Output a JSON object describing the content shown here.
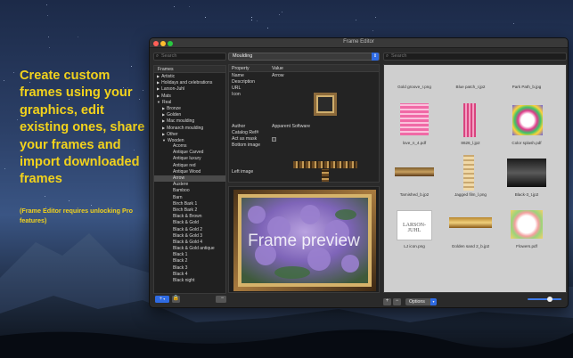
{
  "promo": {
    "headline": "Create custom frames using your graphics, edit existing ones, share your frames and import downloaded frames",
    "note": "(Frame Editor requires unlocking Pro features)"
  },
  "window": {
    "title": "Frame Editor",
    "traffic_lights": {
      "close": "#ff5f57",
      "minimize": "#febc2e",
      "zoom": "#28c840"
    }
  },
  "left_pane": {
    "search_placeholder": "Search",
    "header": "Frames",
    "tree": [
      {
        "label": "Artistic",
        "indent": 0,
        "arrow": "▶"
      },
      {
        "label": "Holidays and celebrations",
        "indent": 0,
        "arrow": "▶"
      },
      {
        "label": "Larson-Juhl",
        "indent": 0,
        "arrow": "▶"
      },
      {
        "label": "Mats",
        "indent": 0,
        "arrow": "▶"
      },
      {
        "label": "Real",
        "indent": 0,
        "arrow": "▼"
      },
      {
        "label": "Bronze",
        "indent": 1,
        "arrow": "▶"
      },
      {
        "label": "Golden",
        "indent": 1,
        "arrow": "▶"
      },
      {
        "label": "Mac moulding",
        "indent": 1,
        "arrow": "▶"
      },
      {
        "label": "Monarch moulding",
        "indent": 1,
        "arrow": "▶"
      },
      {
        "label": "Other",
        "indent": 1,
        "arrow": "▶"
      },
      {
        "label": "Wooden",
        "indent": 1,
        "arrow": "▼"
      },
      {
        "label": "Acorns",
        "indent": 2,
        "arrow": ""
      },
      {
        "label": "Antique Carved",
        "indent": 2,
        "arrow": ""
      },
      {
        "label": "Antique luxury",
        "indent": 2,
        "arrow": ""
      },
      {
        "label": "Antique red",
        "indent": 2,
        "arrow": ""
      },
      {
        "label": "Antique Wood",
        "indent": 2,
        "arrow": ""
      },
      {
        "label": "Arrow",
        "indent": 2,
        "arrow": "",
        "selected": true
      },
      {
        "label": "Austere",
        "indent": 2,
        "arrow": ""
      },
      {
        "label": "Bamboo",
        "indent": 2,
        "arrow": ""
      },
      {
        "label": "Barn",
        "indent": 2,
        "arrow": ""
      },
      {
        "label": "Birch Bark 1",
        "indent": 2,
        "arrow": ""
      },
      {
        "label": "Birch Bark 2",
        "indent": 2,
        "arrow": ""
      },
      {
        "label": "Black & Brown",
        "indent": 2,
        "arrow": ""
      },
      {
        "label": "Black & Gold",
        "indent": 2,
        "arrow": ""
      },
      {
        "label": "Black & Gold 2",
        "indent": 2,
        "arrow": ""
      },
      {
        "label": "Black & Gold 3",
        "indent": 2,
        "arrow": ""
      },
      {
        "label": "Black & Gold 4",
        "indent": 2,
        "arrow": ""
      },
      {
        "label": "Black & Gold antique",
        "indent": 2,
        "arrow": ""
      },
      {
        "label": "Black 1",
        "indent": 2,
        "arrow": ""
      },
      {
        "label": "Black 2",
        "indent": 2,
        "arrow": ""
      },
      {
        "label": "Black 3",
        "indent": 2,
        "arrow": ""
      },
      {
        "label": "Black 4",
        "indent": 2,
        "arrow": ""
      },
      {
        "label": "Black night",
        "indent": 2,
        "arrow": ""
      }
    ],
    "add_label": "+",
    "remove_label": "−"
  },
  "middle_pane": {
    "dropdown_value": "Moulding",
    "col_property": "Property",
    "col_value": "Value",
    "properties": [
      {
        "name": "Name",
        "value": "Arrow"
      },
      {
        "name": "Description",
        "value": ""
      },
      {
        "name": "URL",
        "value": ""
      },
      {
        "name": "Icon",
        "value": ""
      },
      {
        "name": "Author",
        "value": "Apparent Software"
      },
      {
        "name": "Catalog Ref#",
        "value": ""
      },
      {
        "name": "Act as mask",
        "value": ""
      },
      {
        "name": "Bottom image",
        "value": ""
      },
      {
        "name": "Left image",
        "value": ""
      }
    ],
    "preview_label": "Frame preview",
    "remove_label": "−"
  },
  "right_pane": {
    "search_placeholder": "Search",
    "thumbnails": [
      {
        "label": "Gold groove_r.png"
      },
      {
        "label": "Blue patch_r.jp2"
      },
      {
        "label": "Park Path_b.jpg"
      },
      {
        "label": "love_n_4.pdf"
      },
      {
        "label": "8626_l.jp2"
      },
      {
        "label": "Color splash.pdf"
      },
      {
        "label": "Tarnished_b.jp2"
      },
      {
        "label": "Jagged film_l.png"
      },
      {
        "label": "Black-3_t.jp2"
      },
      {
        "label": "LJ icon.png"
      },
      {
        "label": "Golden sand 2_b.jp2"
      },
      {
        "label": "Flowers.pdf"
      }
    ],
    "logo_text": "LARSON-JUHL",
    "options_label": "Options",
    "add_label": "+",
    "remove_label": "−",
    "zoom_level": 0.6
  },
  "colors": {
    "accent": "#2f6be3",
    "promo_text": "#f2d21c"
  }
}
